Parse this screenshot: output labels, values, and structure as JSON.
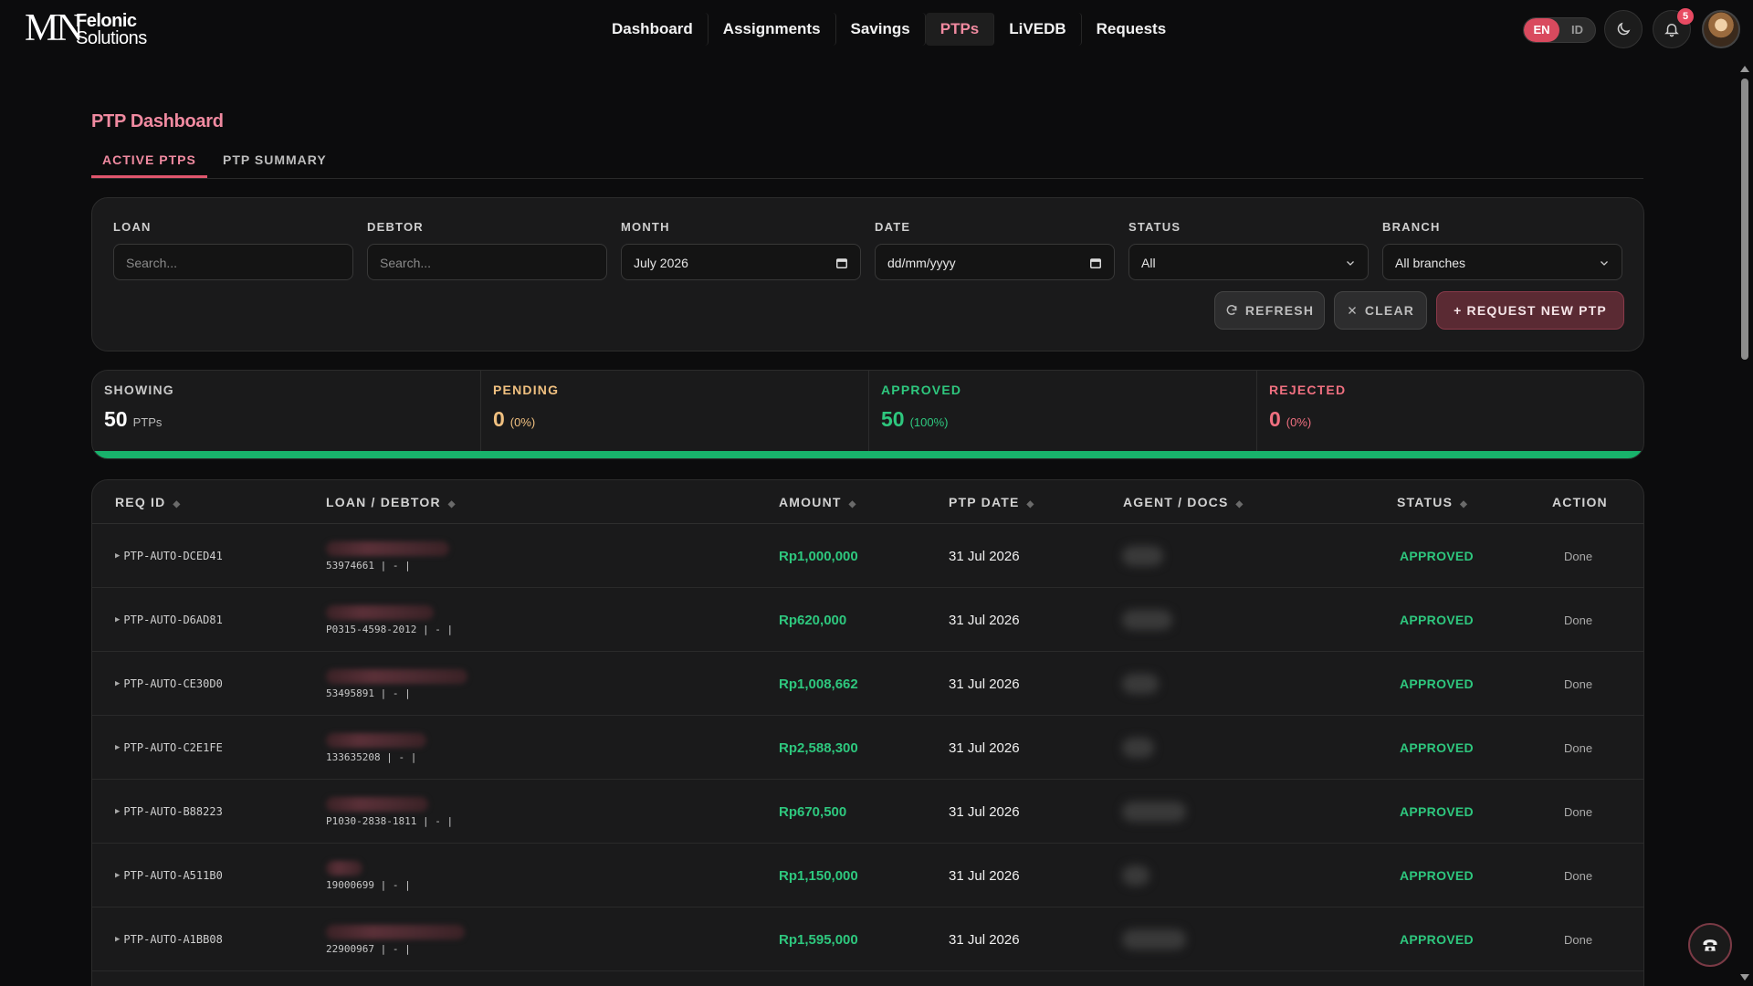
{
  "brand": {
    "mark": "MN",
    "line1": "Felonic",
    "line2": "Solutions"
  },
  "nav": {
    "items": [
      "Dashboard",
      "Assignments",
      "Savings",
      "PTPs",
      "LiVEDB",
      "Requests"
    ],
    "active": "PTPs"
  },
  "lang": {
    "en": "EN",
    "id": "ID",
    "active": "EN"
  },
  "notifications": {
    "count": "5"
  },
  "page": {
    "title": "PTP Dashboard"
  },
  "tabs": [
    {
      "label": "ACTIVE PTPS",
      "active": true
    },
    {
      "label": "PTP SUMMARY",
      "active": false
    }
  ],
  "filters": {
    "loan": {
      "label": "LOAN",
      "placeholder": "Search..."
    },
    "debtor": {
      "label": "DEBTOR",
      "placeholder": "Search..."
    },
    "month": {
      "label": "MONTH",
      "value": "July 2026"
    },
    "date": {
      "label": "DATE",
      "placeholder": "dd/mm/yyyy"
    },
    "status": {
      "label": "STATUS",
      "value": "All"
    },
    "branch": {
      "label": "BRANCH",
      "value": "All branches"
    },
    "refresh": "REFRESH",
    "clear": "CLEAR",
    "request_new": "+ REQUEST NEW PTP"
  },
  "stats": {
    "showing": {
      "label": "SHOWING",
      "value": "50",
      "sub": "PTPs"
    },
    "pending": {
      "label": "PENDING",
      "value": "0",
      "sub": "(0%)"
    },
    "approved": {
      "label": "APPROVED",
      "value": "50",
      "sub": "(100%)"
    },
    "rejected": {
      "label": "REJECTED",
      "value": "0",
      "sub": "(0%)"
    },
    "approved_fraction": 1.0
  },
  "colors": {
    "accent": "#f08aa0",
    "approved": "#2ec77e",
    "pending": "#f0c080",
    "rejected": "#f07080"
  },
  "table": {
    "headers": {
      "req_id": "REQ ID",
      "loan_debtor": "LOAN / DEBTOR",
      "amount": "AMOUNT",
      "ptp_date": "PTP DATE",
      "agent_docs": "AGENT / DOCS",
      "status": "STATUS",
      "action": "ACTION"
    },
    "sort_icon": "◆",
    "rows": [
      {
        "req_id": "PTP-AUTO-DCED41",
        "loan_line": "53974661 | - |",
        "amount": "Rp1,000,000",
        "ptp_date": "31 Jul 2026",
        "status": "APPROVED",
        "action": "Done"
      },
      {
        "req_id": "PTP-AUTO-D6AD81",
        "loan_line": "P0315-4598-2012 | - |",
        "amount": "Rp620,000",
        "ptp_date": "31 Jul 2026",
        "status": "APPROVED",
        "action": "Done"
      },
      {
        "req_id": "PTP-AUTO-CE30D0",
        "loan_line": "53495891 | - |",
        "amount": "Rp1,008,662",
        "ptp_date": "31 Jul 2026",
        "status": "APPROVED",
        "action": "Done"
      },
      {
        "req_id": "PTP-AUTO-C2E1FE",
        "loan_line": "133635208 | - |",
        "amount": "Rp2,588,300",
        "ptp_date": "31 Jul 2026",
        "status": "APPROVED",
        "action": "Done"
      },
      {
        "req_id": "PTP-AUTO-B88223",
        "loan_line": "P1030-2838-1811 | - |",
        "amount": "Rp670,500",
        "ptp_date": "31 Jul 2026",
        "status": "APPROVED",
        "action": "Done"
      },
      {
        "req_id": "PTP-AUTO-A511B0",
        "loan_line": "19000699 | - |",
        "amount": "Rp1,150,000",
        "ptp_date": "31 Jul 2026",
        "status": "APPROVED",
        "action": "Done"
      },
      {
        "req_id": "PTP-AUTO-A1BB08",
        "loan_line": "22900967 | - |",
        "amount": "Rp1,595,000",
        "ptp_date": "31 Jul 2026",
        "status": "APPROVED",
        "action": "Done"
      }
    ]
  }
}
